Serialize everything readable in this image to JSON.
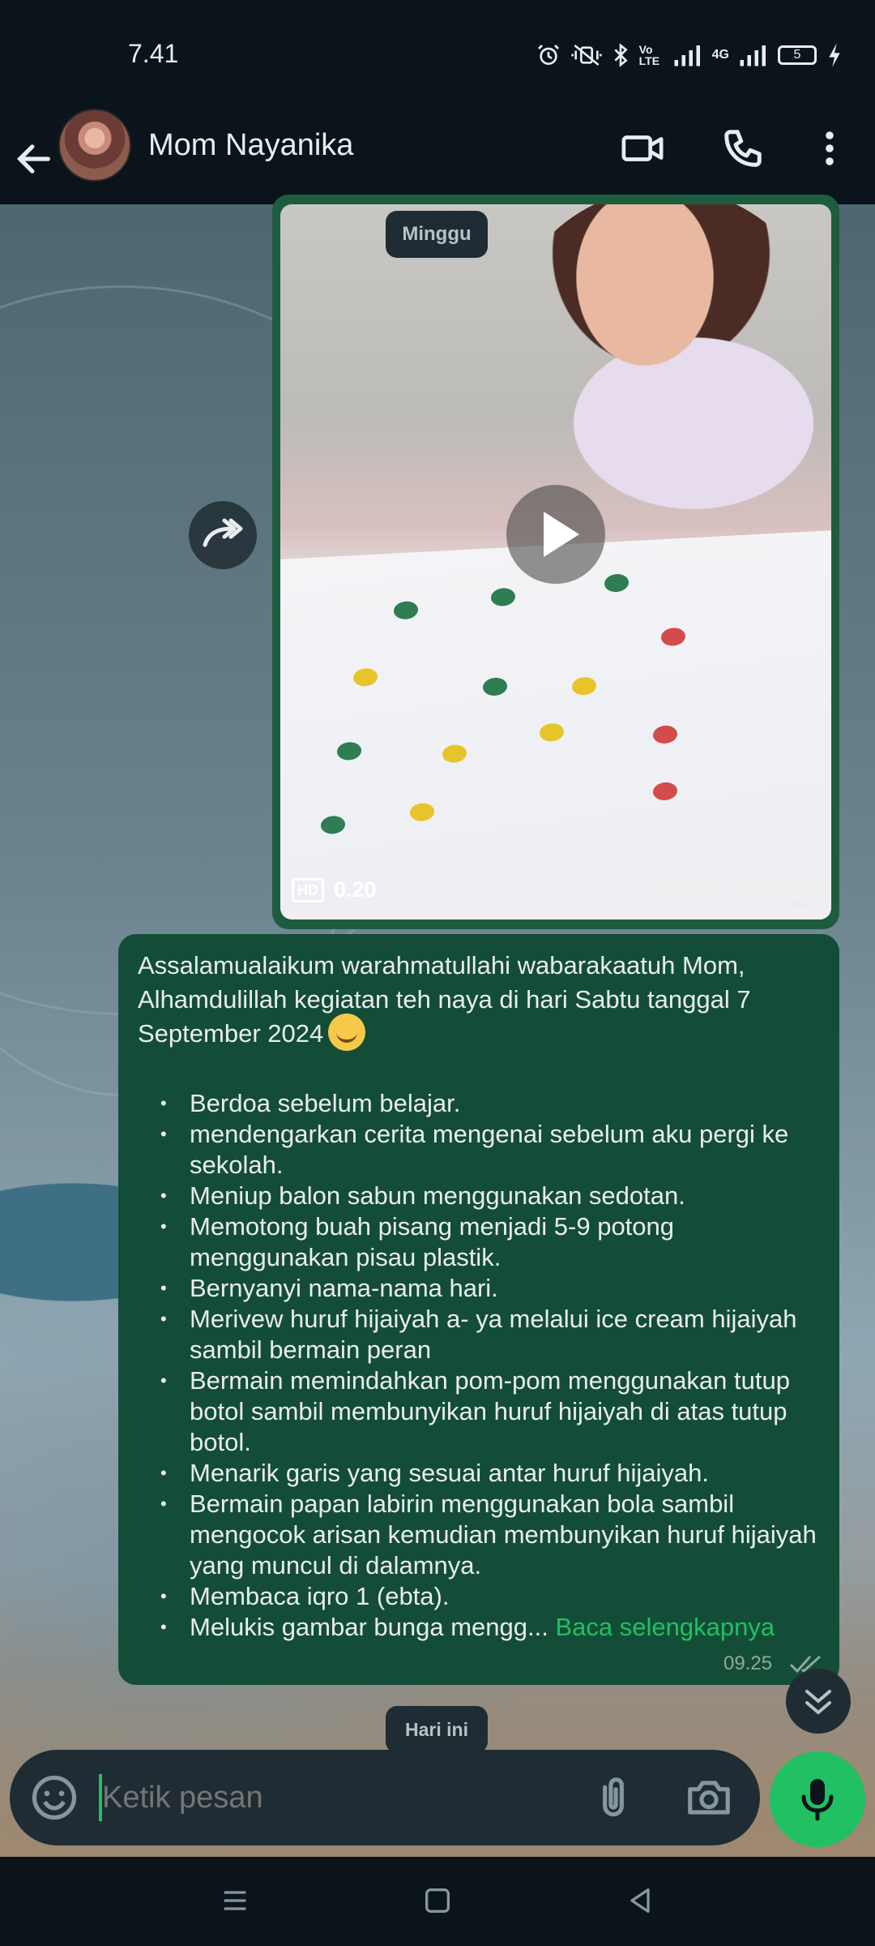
{
  "status_bar": {
    "time": "7.41",
    "lte_label": "Vo LTE",
    "network_label": "4G",
    "battery_level": "5"
  },
  "header": {
    "contact_name": "Mom Nayanika",
    "icons": [
      "back-arrow-icon",
      "video-call-icon",
      "phone-icon",
      "more-vert-icon"
    ]
  },
  "chat": {
    "date_chip_top": "Minggu",
    "video_message": {
      "hd_label": "HD",
      "duration": "0.20",
      "time": "09.24",
      "status": "read"
    },
    "text_message": {
      "intro": "Assalamualaikum warahmatullahi wabarakaatuh Mom, Alhamdulillah kegiatan teh naya di hari Sabtu tanggal 7 September 2024",
      "items": [
        "Berdoa sebelum belajar.",
        "mendengarkan cerita mengenai sebelum aku pergi ke sekolah.",
        "Meniup balon sabun menggunakan sedotan.",
        "Memotong  buah pisang menjadi 5-9 potong menggunakan pisau plastik.",
        "Bernyanyi nama-nama hari.",
        "Merivew huruf hijaiyah a- ya melalui ice cream hijaiyah sambil bermain peran",
        "Bermain memindahkan pom-pom menggunakan tutup botol sambil membunyikan huruf hijaiyah di atas tutup botol.",
        "Menarik garis yang sesuai antar huruf hijaiyah.",
        "Bermain papan labirin menggunakan bola sambil mengocok arisan kemudian membunyikan huruf hijaiyah yang muncul di dalamnya.",
        "Membaca iqro 1 (ebta).",
        "Melukis gambar bunga mengg..."
      ],
      "read_more": "Baca selengkapnya",
      "time": "09.25",
      "status": "read"
    },
    "date_chip_bottom": "Hari ini"
  },
  "composer": {
    "placeholder": "Ketik pesan"
  },
  "colors": {
    "accent": "#21c063",
    "bubble_out": "#144d37",
    "app_bar": "#0b141a"
  }
}
